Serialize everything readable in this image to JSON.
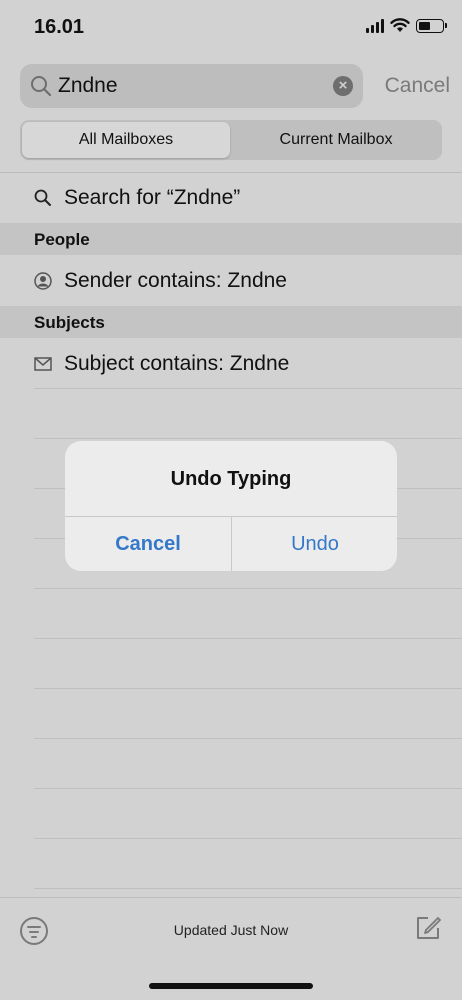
{
  "status_bar": {
    "time": "16.01",
    "battery_level": 0.5
  },
  "search": {
    "query": "Zndne",
    "cancel_label": "Cancel"
  },
  "scope": {
    "all_label": "All Mailboxes",
    "current_label": "Current Mailbox",
    "selected": "All Mailboxes"
  },
  "suggestions": {
    "search_for": "Search for “Zndne”",
    "people_header": "People",
    "sender": "Sender contains: Zndne",
    "subjects_header": "Subjects",
    "subject": "Subject contains: Zndne"
  },
  "footer": {
    "status": "Updated Just Now"
  },
  "alert": {
    "title": "Undo Typing",
    "cancel_label": "Cancel",
    "undo_label": "Undo"
  },
  "colors": {
    "accent": "#3478c9",
    "overlay_bg": "#d2d2d2",
    "alert_bg": "#ececec"
  },
  "icons": [
    "search-icon",
    "clear-icon",
    "person-circle-icon",
    "envelope-icon",
    "filter-icon",
    "compose-icon",
    "wifi-icon",
    "signal-icon",
    "battery-icon"
  ]
}
